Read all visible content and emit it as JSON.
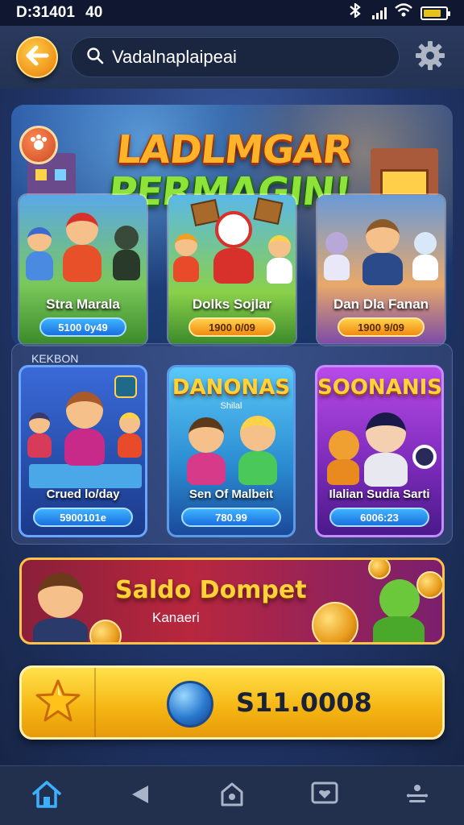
{
  "status_bar": {
    "time": "D:31401",
    "extra": "40"
  },
  "search": {
    "query": "Vadalnaplaipeai"
  },
  "banner": {
    "title_line1": "LADLMGAR",
    "title_line2": "PERMAGIN!",
    "cards": [
      {
        "title": "Stra Marala",
        "price": "5100 0y49"
      },
      {
        "title": "Dolks Sojlar",
        "price": "1900 0/09"
      },
      {
        "title": "Dan Dla Fanan",
        "price": "1900 9/09"
      }
    ]
  },
  "section": {
    "label": "KEKBON",
    "cards": [
      {
        "title": "",
        "subtitle": "",
        "caption": "Crued lo/day",
        "price": "5900101e"
      },
      {
        "title": "DANONAS",
        "subtitle": "Shilal",
        "caption": "Sen Of Malbeit",
        "price": "780.99"
      },
      {
        "title": "SOONANIS",
        "subtitle": "",
        "caption": "Ilalian Sudia Sarti",
        "price": "6006:23"
      }
    ]
  },
  "saldo": {
    "title": "Saldo Dompet",
    "subtitle": "Kanaeri"
  },
  "balance": {
    "amount": "S11.0008"
  },
  "colors": {
    "accent": "#f5b412",
    "banner_green": "#8ee33a",
    "pill_blue": "#1a6fe0"
  }
}
